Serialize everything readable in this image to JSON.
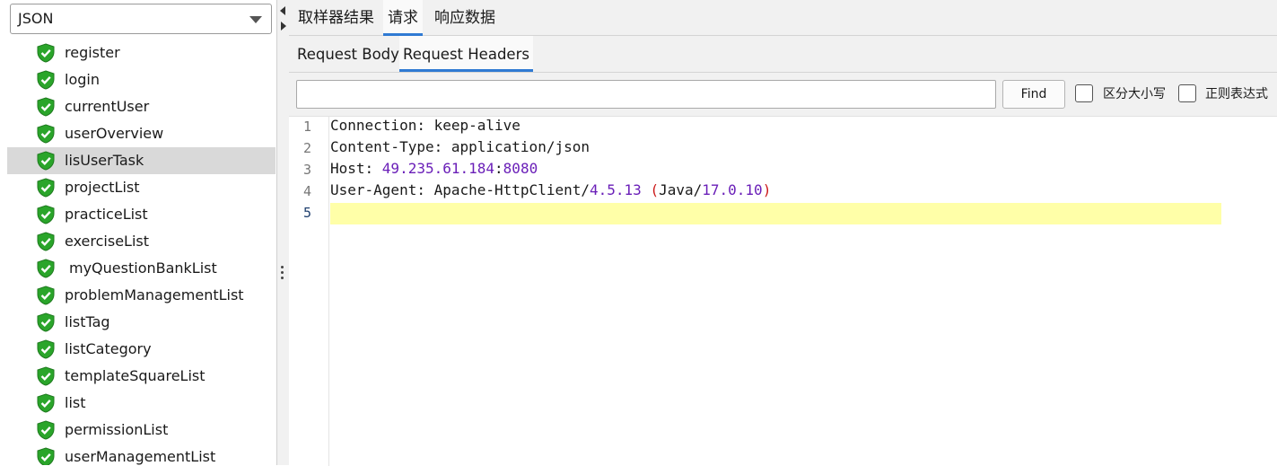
{
  "left_panel": {
    "renderer_select": {
      "value": "JSON"
    },
    "tree_items": [
      {
        "label": "register"
      },
      {
        "label": "login"
      },
      {
        "label": "currentUser"
      },
      {
        "label": "userOverview"
      },
      {
        "label": "lisUserTask",
        "selected": true
      },
      {
        "label": "projectList"
      },
      {
        "label": "practiceList"
      },
      {
        "label": "exerciseList"
      },
      {
        "label": "myQuestionBankList"
      },
      {
        "label": "problemManagementList"
      },
      {
        "label": "listTag"
      },
      {
        "label": "listCategory"
      },
      {
        "label": "templateSquareList"
      },
      {
        "label": "list"
      },
      {
        "label": "permissionList"
      },
      {
        "label": "userManagementList"
      }
    ]
  },
  "top_tabs": [
    {
      "label": "取样器结果"
    },
    {
      "label": "请求",
      "active": true
    },
    {
      "label": "响应数据"
    }
  ],
  "sub_tabs": [
    {
      "label": "Request Body"
    },
    {
      "label": "Request Headers",
      "active": true
    }
  ],
  "find_bar": {
    "search_value": "",
    "find_label": "Find",
    "case_sensitive_label": "区分大小写",
    "case_sensitive_checked": false,
    "regex_label": "正则表达式",
    "regex_checked": false
  },
  "editor": {
    "line_numbers": [
      "1",
      "2",
      "3",
      "4",
      "5"
    ],
    "current_line": "5",
    "lines": [
      {
        "key": "Connection",
        "sep": ": ",
        "value": "keep-alive"
      },
      {
        "key": "Content-Type",
        "sep": ": ",
        "value": "application/json"
      },
      {
        "key": "Host",
        "sep": ": ",
        "host": "49.235.61.184",
        "colon": ":",
        "port": "8080"
      },
      {
        "key": "User-Agent",
        "sep": ": ",
        "agent": "Apache-HttpClient",
        "slash1": "/",
        "agent_version": "4.5.13",
        "space": " ",
        "open": "(",
        "java": "Java",
        "slash2": "/",
        "java_version": "17.0.10",
        "close": ")"
      },
      {
        "text": ""
      }
    ]
  },
  "colors": {
    "accent_tab_underline": "#2f7ad3",
    "selected_row": "#d9d9d9",
    "current_line_highlight": "#ffffa8",
    "number_token": "#6a1fb8",
    "paren_token": "#cc1a1a",
    "status_icon": "#2aa52a"
  },
  "icons": {
    "tree_item_status": "green-shield-check-icon",
    "select_arrow": "chevron-down-icon"
  }
}
